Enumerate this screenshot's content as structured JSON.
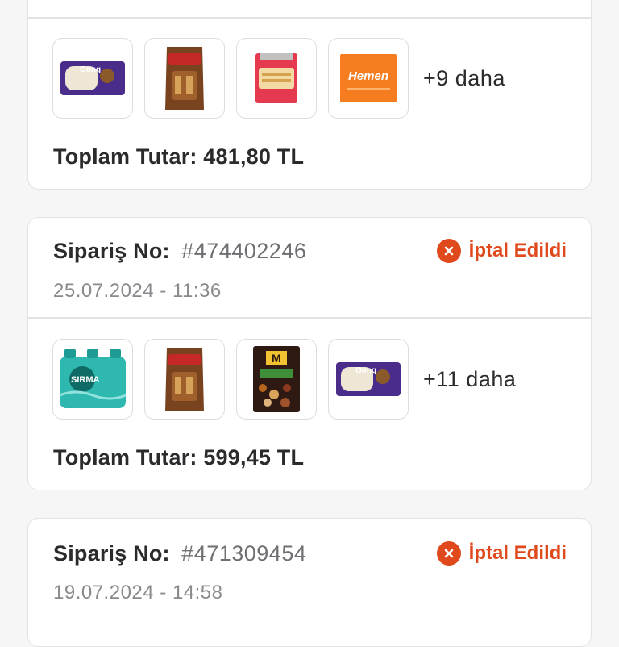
{
  "orders": [
    {
      "products": [
        {
          "name": "Gong",
          "icon": "gong-pack-icon"
        },
        {
          "name": "Albeni",
          "icon": "albeni-bag-icon"
        },
        {
          "name": "Ülker Çubuk",
          "icon": "cubuk-pack-icon"
        },
        {
          "name": "Hemen",
          "icon": "hemen-bag-icon"
        }
      ],
      "more_label": "+9 daha",
      "total_label": "Toplam Tutar:",
      "total_value": "481,80 TL"
    },
    {
      "order_label": "Sipariş No:",
      "order_number": "#474402246",
      "date": "25.07.2024 - 11:36",
      "status": "İptal Edildi",
      "products": [
        {
          "name": "Sırma",
          "icon": "sirma-water-icon"
        },
        {
          "name": "Albeni",
          "icon": "albeni-bag-icon"
        },
        {
          "name": "Çiğ Karışık Kuruyemiş",
          "icon": "nuts-bag-icon"
        },
        {
          "name": "Gong",
          "icon": "gong-pack-icon"
        }
      ],
      "more_label": "+11 daha",
      "total_label": "Toplam Tutar:",
      "total_value": "599,45 TL"
    },
    {
      "order_label": "Sipariş No:",
      "order_number": "#471309454",
      "date": "19.07.2024 - 14:58",
      "status": "İptal Edildi"
    }
  ],
  "colors": {
    "status_cancelled": "#e0491c",
    "card_border": "#e2e2e4",
    "background": "#f6f6f7"
  }
}
